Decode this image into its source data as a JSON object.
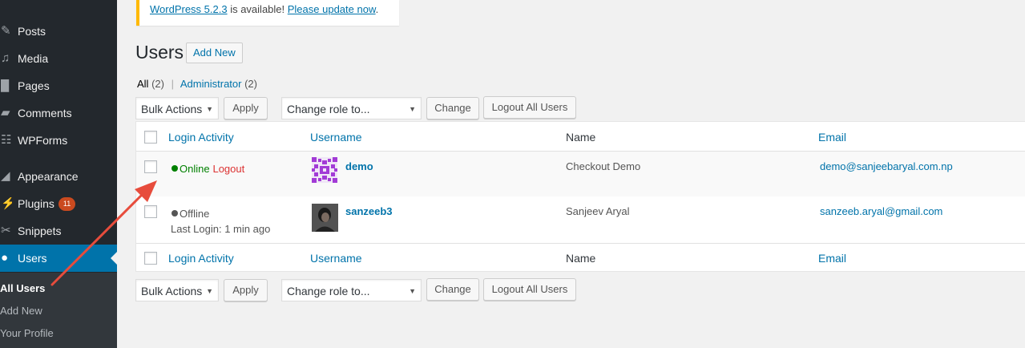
{
  "sidebar": {
    "items": [
      {
        "label": "Posts",
        "icon": "pin-icon"
      },
      {
        "label": "Media",
        "icon": "media-icon"
      },
      {
        "label": "Pages",
        "icon": "page-icon"
      },
      {
        "label": "Comments",
        "icon": "comment-icon"
      },
      {
        "label": "WPForms",
        "icon": "forms-icon"
      },
      {
        "label": "Appearance",
        "icon": "brush-icon"
      },
      {
        "label": "Plugins",
        "icon": "plugin-icon",
        "badge": "11"
      },
      {
        "label": "Snippets",
        "icon": "scissors-icon"
      },
      {
        "label": "Users",
        "icon": "user-icon"
      }
    ],
    "submenu": [
      "All Users",
      "Add New",
      "Your Profile"
    ]
  },
  "notice": {
    "version_link": "WordPress 5.2.3",
    "middle": " is available! ",
    "update_link": "Please update now",
    "end": "."
  },
  "page": {
    "title": "Users",
    "add_new": "Add New"
  },
  "filters": {
    "all": "All",
    "all_count": "(2)",
    "sep": "|",
    "admin": "Administrator",
    "admin_count": "(2)"
  },
  "bulk": {
    "bulk_actions": "Bulk Actions",
    "apply": "Apply",
    "change_role": "Change role to...",
    "change": "Change",
    "logout_all": "Logout All Users"
  },
  "table": {
    "columns": [
      "Login Activity",
      "Username",
      "Name",
      "Email"
    ],
    "rows": [
      {
        "status": "Online",
        "action": "Logout",
        "username": "demo",
        "name": "Checkout Demo",
        "email": "demo@sanjeebaryal.com.np"
      },
      {
        "status": "Offline",
        "last_login": "Last Login: 1 min ago",
        "username": "sanzeeb3",
        "name": "Sanjeev Aryal",
        "email": "sanzeeb.aryal@gmail.com"
      }
    ]
  },
  "colors": {
    "sidebar": "#23282d",
    "accent": "#0073aa",
    "online": "#008000",
    "logout": "#dc3232",
    "annotation": "#e74c3c"
  }
}
